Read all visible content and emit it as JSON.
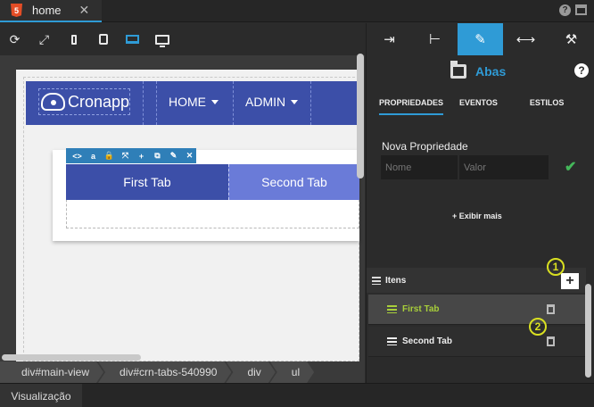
{
  "tabbar": {
    "file_badge": "5",
    "file_name": "home",
    "close": "✕",
    "help": "?"
  },
  "toolbar": {
    "refresh_icon": "⟳",
    "expand_icon": "⤢"
  },
  "page": {
    "logo_text": "Cronapp",
    "nav": [
      {
        "label": "HOME"
      },
      {
        "label": "ADMIN"
      }
    ],
    "component_toolbar": [
      "<>",
      "a",
      "🔒",
      "⤧",
      "+",
      "⧉",
      "✎",
      "✕"
    ],
    "tabs": [
      {
        "label": "First Tab"
      },
      {
        "label": "Second Tab"
      }
    ]
  },
  "breadcrumb": [
    "div#main-view",
    "div#crn-tabs-540990",
    "div",
    "ul"
  ],
  "bottom": {
    "tab": "Visualização"
  },
  "panel": {
    "component_name": "Abas",
    "help": "?",
    "subtabs": [
      "PROPRIEDADES",
      "EVENTOS",
      "ESTILOS"
    ],
    "new_property_label": "Nova Propriedade",
    "name_placeholder": "Nome",
    "value_placeholder": "Valor",
    "check": "✔",
    "show_more": "+ Exibir mais",
    "items_label": "Itens",
    "add": "+",
    "items": [
      {
        "label": "First Tab",
        "selected": true
      },
      {
        "label": "Second Tab",
        "selected": false
      }
    ],
    "callouts": [
      "1",
      "2"
    ]
  },
  "colors": {
    "accent": "#2f9bd6",
    "navbar": "#3c4fa8",
    "second_tab": "#6a7bd8",
    "selected_item": "#a8cf3a",
    "callout": "#d9e021"
  }
}
